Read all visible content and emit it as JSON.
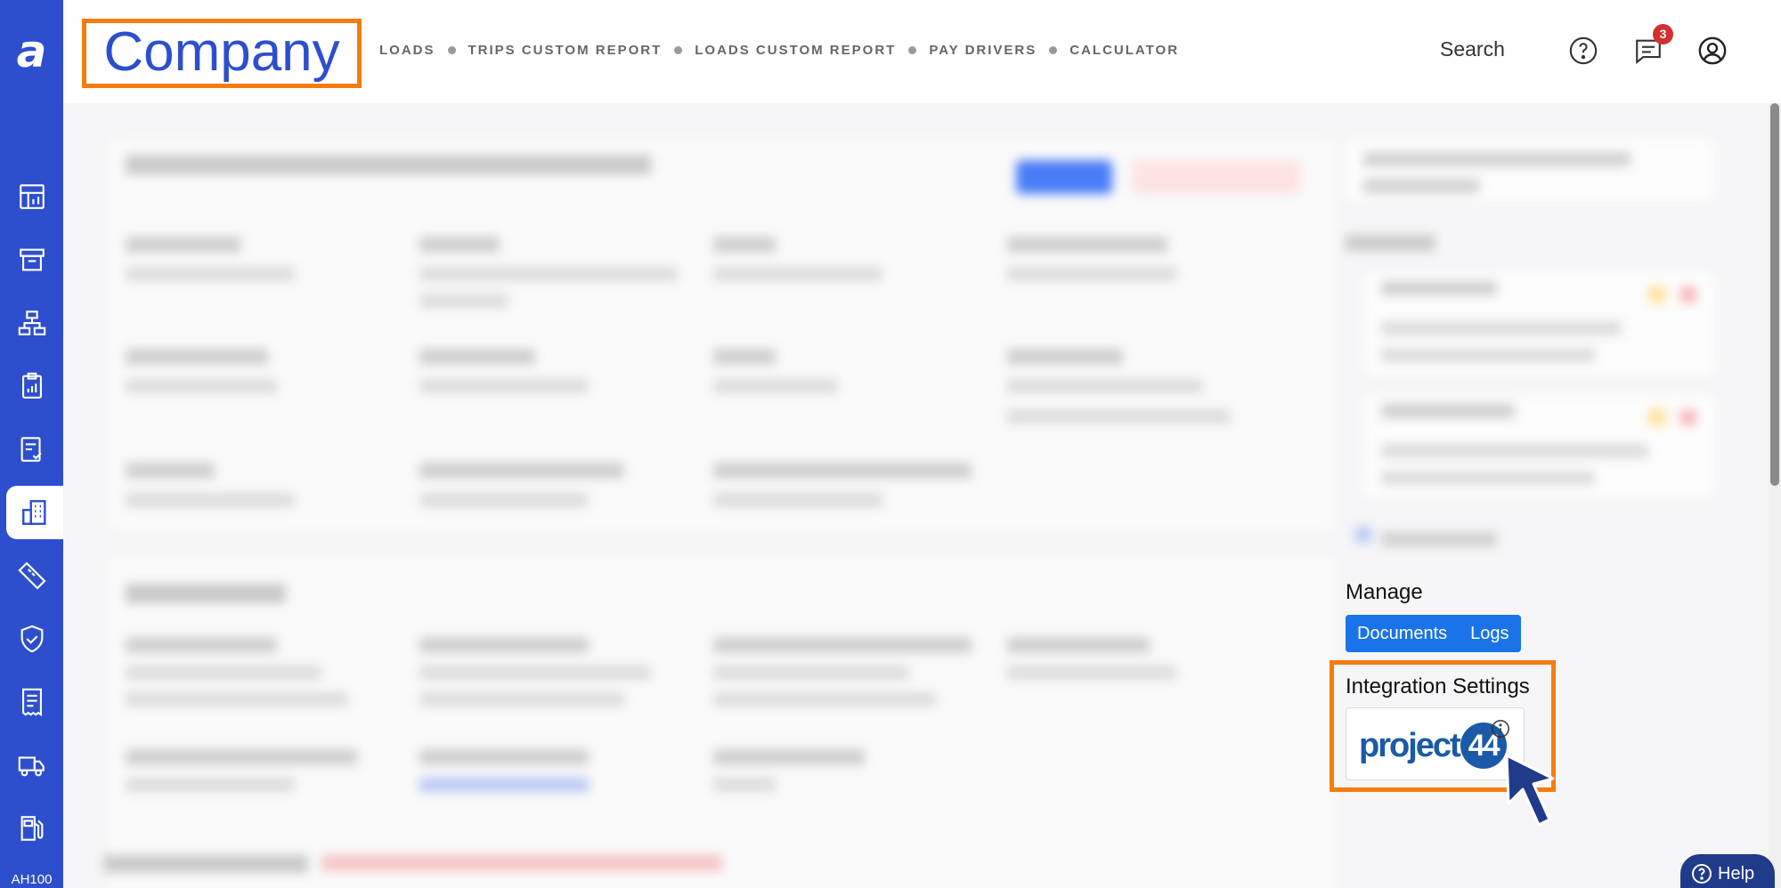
{
  "app": {
    "logo_glyph": "a",
    "account_code": "AH100"
  },
  "header": {
    "page_title": "Company",
    "nav": [
      "LOADS",
      "TRIPS CUSTOM REPORT",
      "LOADS CUSTOM REPORT",
      "PAY DRIVERS",
      "CALCULATOR"
    ],
    "search_label": "Search",
    "notification_count": "3"
  },
  "sidebar": {
    "items": [
      {
        "icon": "dashboard-icon"
      },
      {
        "icon": "archive-icon"
      },
      {
        "icon": "hierarchy-icon"
      },
      {
        "icon": "clipboard-icon"
      },
      {
        "icon": "checklist-icon"
      },
      {
        "icon": "building-icon",
        "active": true
      },
      {
        "icon": "ruler-icon"
      },
      {
        "icon": "shield-check-icon"
      },
      {
        "icon": "receipt-icon"
      },
      {
        "icon": "truck-icon"
      },
      {
        "icon": "fuel-icon"
      }
    ]
  },
  "right_panel": {
    "manage_title": "Manage",
    "manage_buttons": [
      "Documents",
      "Logs"
    ],
    "integration_title": "Integration Settings",
    "integration_logo_text": "project",
    "integration_logo_number": "44"
  },
  "help_label": "Help",
  "colors": {
    "sidebar": "#2d4fce",
    "highlight": "#f57c10",
    "primary_button": "#1a73e8",
    "help_button": "#1f3b8a",
    "badge": "#d32f2f"
  }
}
